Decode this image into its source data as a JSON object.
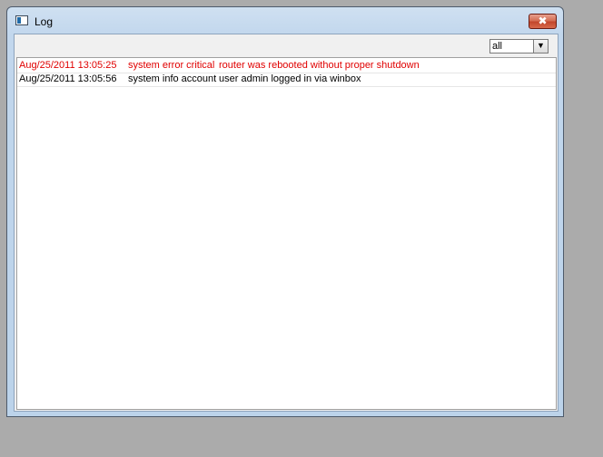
{
  "window": {
    "title": "Log",
    "close_label": "✖"
  },
  "filter": {
    "value": "all",
    "arrow": "▼"
  },
  "log": {
    "entries": [
      {
        "time": "Aug/25/2011 13:05:25",
        "topics": "system error critical",
        "message": "router was rebooted without proper shutdown",
        "level": "error"
      },
      {
        "time": "Aug/25/2011 13:05:56",
        "topics": "system info account",
        "message": "user admin logged in via winbox",
        "level": "info"
      }
    ]
  },
  "colors": {
    "error_text": "#e00000",
    "info_text": "#000000",
    "desktop": "#ababab"
  }
}
